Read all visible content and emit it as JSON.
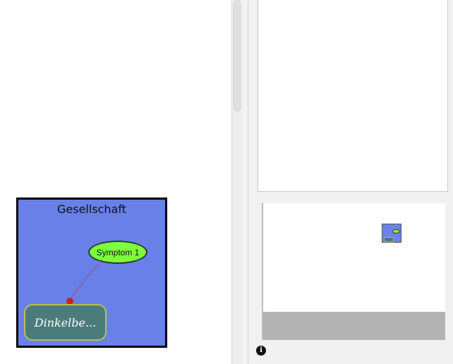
{
  "canvas": {
    "group": {
      "title": "Gesellschaft"
    },
    "nodes": [
      {
        "label": "Symptom 1"
      },
      {
        "label": "Dinkelbe..."
      }
    ]
  },
  "panel": {
    "info_icon": "i"
  },
  "colors": {
    "group_fill": "#6880e8",
    "ellipse_fill": "#7cff3a",
    "rect_fill": "#4b7c7c",
    "rect_border": "#b8c24a",
    "connector": "#cc2020"
  },
  "icons": [
    "info-icon"
  ]
}
